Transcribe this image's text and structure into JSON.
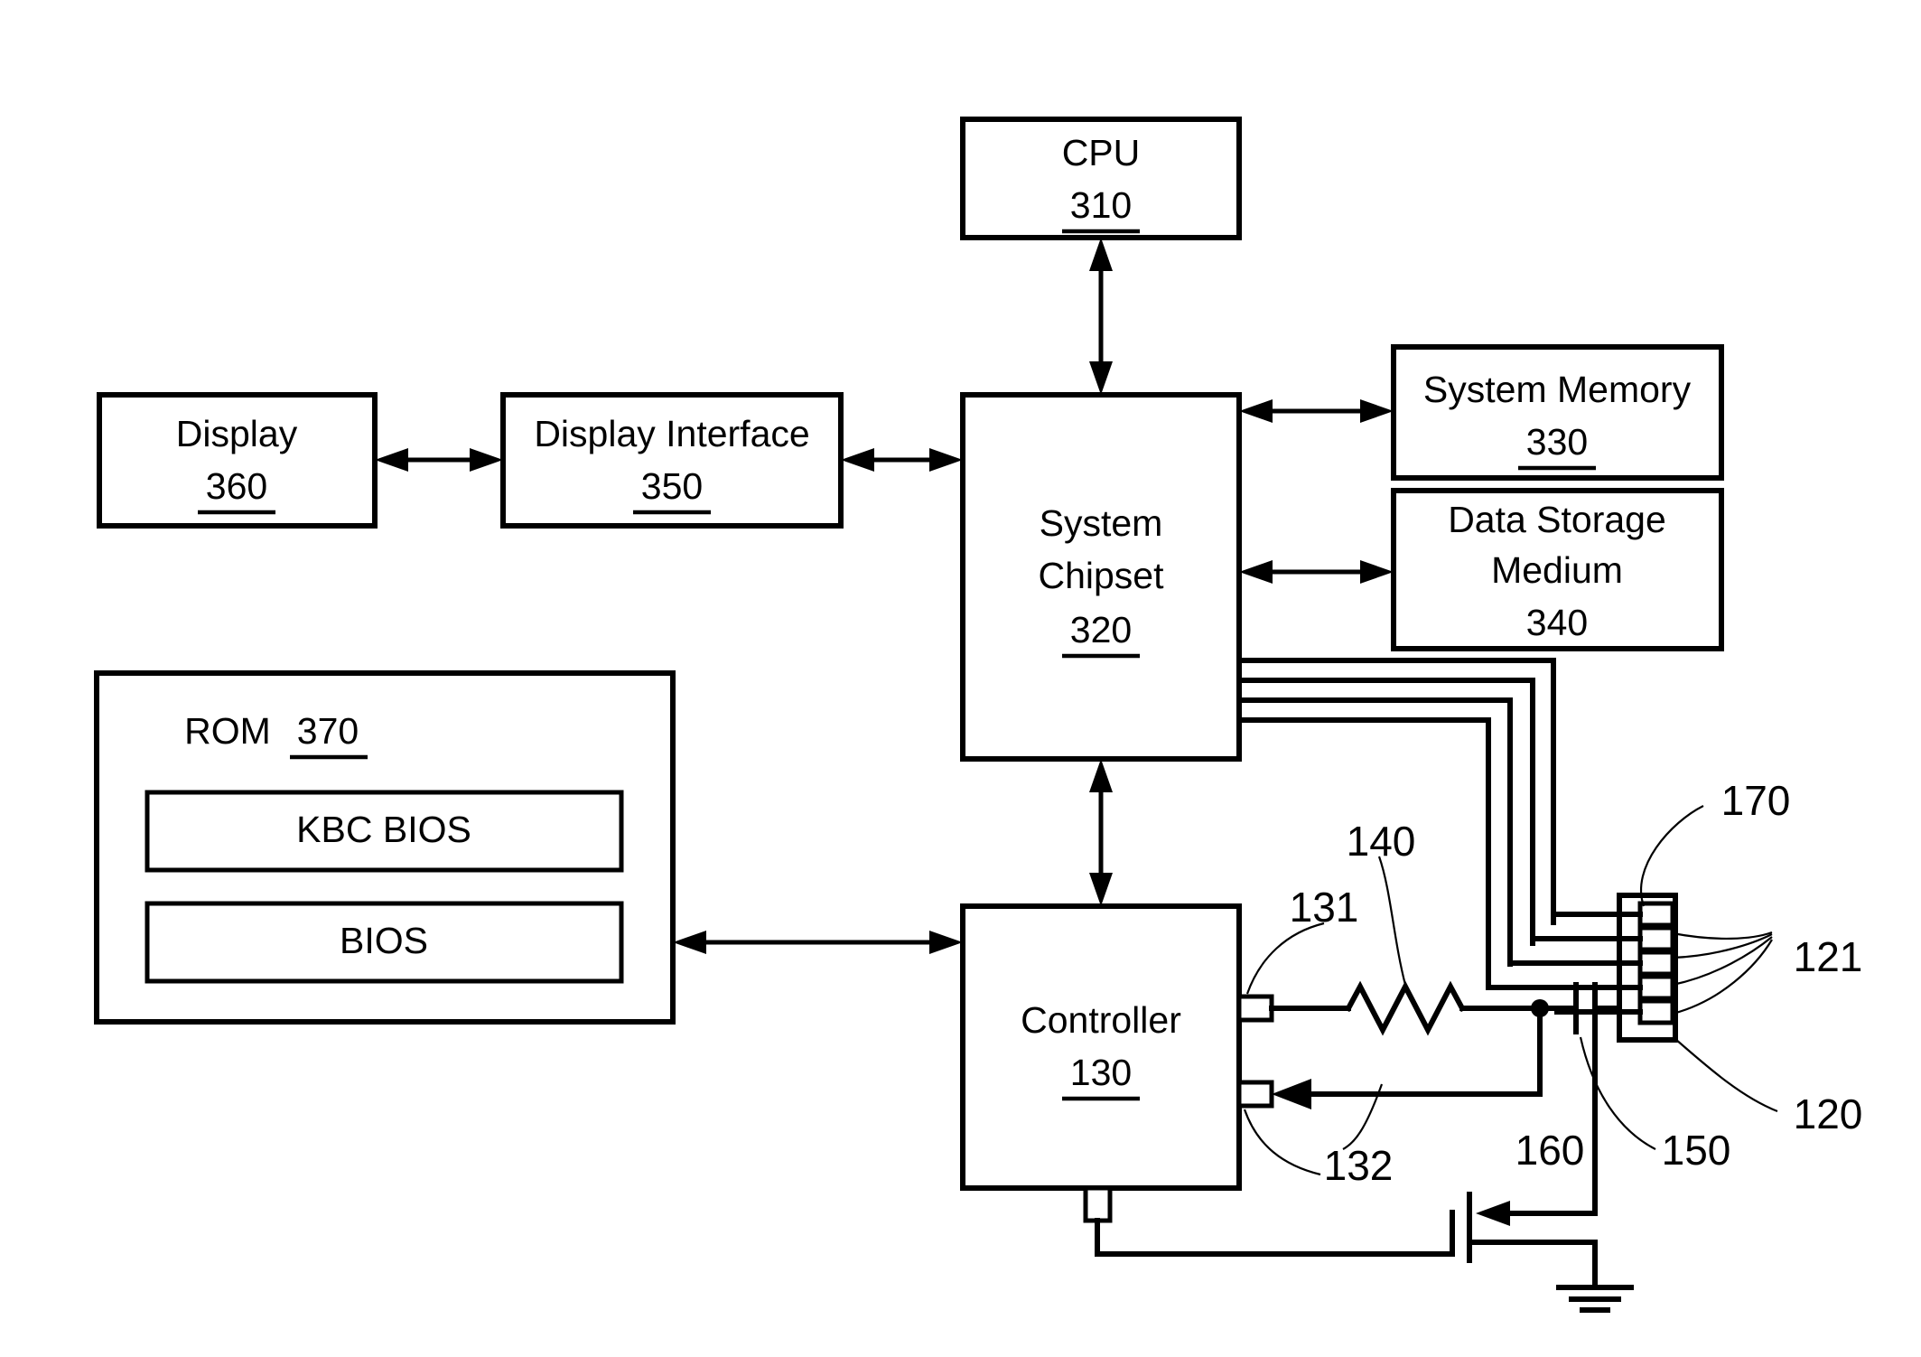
{
  "figure": {
    "type": "patent-block-diagram",
    "title": "Computer system block diagram with keyboard controller and charging circuit"
  },
  "blocks": {
    "cpu": {
      "label": "CPU",
      "ref": "310"
    },
    "chipset": {
      "label_line1": "System",
      "label_line2": "Chipset",
      "ref": "320"
    },
    "system_memory": {
      "label": "System Memory",
      "ref": "330"
    },
    "data_storage": {
      "label_line1": "Data Storage",
      "label_line2": "Medium",
      "ref": "340"
    },
    "display_iface": {
      "label": "Display Interface",
      "ref": "350"
    },
    "display": {
      "label": "Display",
      "ref": "360"
    },
    "rom": {
      "label": "ROM",
      "ref": "370"
    },
    "kbc_bios": {
      "label": "KBC BIOS"
    },
    "bios": {
      "label": "BIOS"
    },
    "controller": {
      "label": "Controller",
      "ref": "130"
    }
  },
  "callouts": {
    "pin_131": {
      "label": "131"
    },
    "pin_132": {
      "label": "132"
    },
    "resistor_140": {
      "label": "140"
    },
    "capacitor_150": {
      "label": "150"
    },
    "feedback_160": {
      "label": "160"
    },
    "connector_170": {
      "label": "170"
    },
    "contacts_121": {
      "label": "121"
    },
    "battery_120": {
      "label": "120"
    }
  },
  "symbols": {
    "resistor": "resistor-zigzag",
    "capacitor": "capacitor-two-plates",
    "transistor": "n-channel-mosfet",
    "ground": "earth-ground",
    "connector": "multi-pin-connector"
  },
  "colors": {
    "line": "#000000",
    "fill": "#ffffff",
    "background": "#ffffff"
  }
}
